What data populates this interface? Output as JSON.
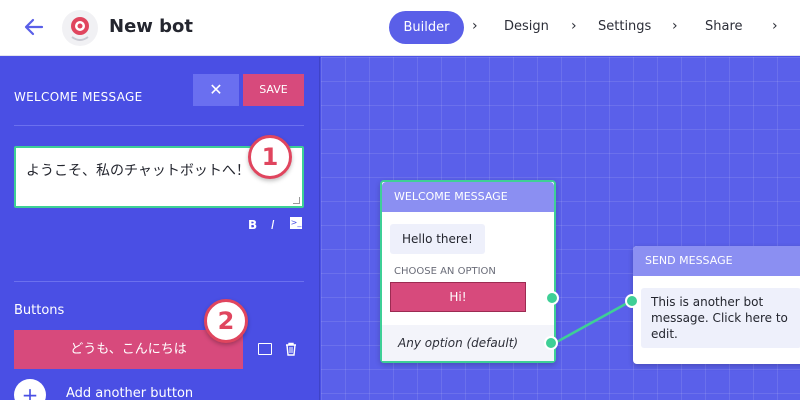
{
  "header": {
    "title": "New bot",
    "breadcrumbs": [
      "Builder",
      "Design",
      "Settings",
      "Share"
    ]
  },
  "panel": {
    "heading": "WELCOME MESSAGE",
    "close_label": "✕",
    "save_label": "SAVE",
    "message_text": "ようこそ、私のチャットボットへ！",
    "format_bold": "B",
    "format_italic": "I",
    "buttons_label": "Buttons",
    "option_button_label": "どうも、こんにちは",
    "add_button_label": "Add another button",
    "add_icon": "+"
  },
  "annotations": [
    "1",
    "2"
  ],
  "canvas": {
    "welcome_node": {
      "title": "WELCOME MESSAGE",
      "message": "Hello there!",
      "choose_label": "CHOOSE AN OPTION",
      "option": "Hi!",
      "default_option": "Any option (default)"
    },
    "send_node": {
      "title": "SEND MESSAGE",
      "message": "This is another bot message. Click here to edit."
    }
  },
  "colors": {
    "accent": "#5a5fe8",
    "panel_bg": "#4a4fe4",
    "save_pink": "#d74a7c",
    "success_green": "#3ecf96",
    "badge_red": "#e0455e"
  }
}
